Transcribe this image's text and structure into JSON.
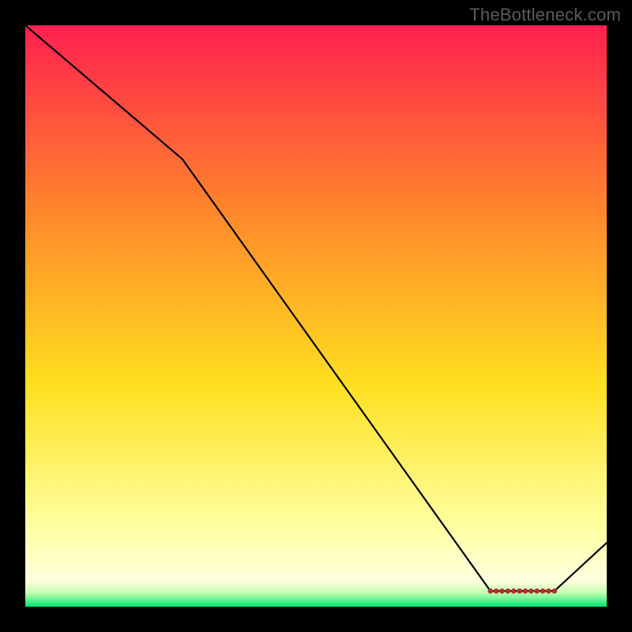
{
  "watermark": "TheBottleneck.com",
  "chart_data": {
    "type": "line",
    "title": "",
    "xlabel": "",
    "ylabel": "",
    "xlim": [
      0,
      100
    ],
    "ylim": [
      0,
      100
    ],
    "grid": false,
    "legend": false,
    "background_gradient": {
      "stops": [
        {
          "t": 0.0,
          "color": "#ff2050"
        },
        {
          "t": 0.33,
          "color": "#ff8a2a"
        },
        {
          "t": 0.62,
          "color": "#ffe020"
        },
        {
          "t": 0.86,
          "color": "#ffffa0"
        },
        {
          "t": 0.955,
          "color": "#ffffe0"
        },
        {
          "t": 0.975,
          "color": "#c8ffb0"
        },
        {
          "t": 1.0,
          "color": "#00e874"
        }
      ]
    },
    "series": [
      {
        "name": "bottleneck-curve",
        "color": "#000000",
        "x": [
          0,
          27,
          80,
          91,
          100
        ],
        "y": [
          100,
          77,
          2.7,
          2.7,
          11
        ]
      }
    ],
    "markers": {
      "name": "optimal-range",
      "color": "#b03030",
      "shape": "circle",
      "points": [
        {
          "x": 80,
          "y": 2.7
        },
        {
          "x": 81,
          "y": 2.7
        },
        {
          "x": 82,
          "y": 2.7
        },
        {
          "x": 83,
          "y": 2.7
        },
        {
          "x": 84,
          "y": 2.7
        },
        {
          "x": 85,
          "y": 2.7
        },
        {
          "x": 86,
          "y": 2.7
        },
        {
          "x": 87,
          "y": 2.7
        },
        {
          "x": 88,
          "y": 2.7
        },
        {
          "x": 89,
          "y": 2.7
        },
        {
          "x": 90,
          "y": 2.7
        },
        {
          "x": 91,
          "y": 2.7
        }
      ]
    }
  }
}
